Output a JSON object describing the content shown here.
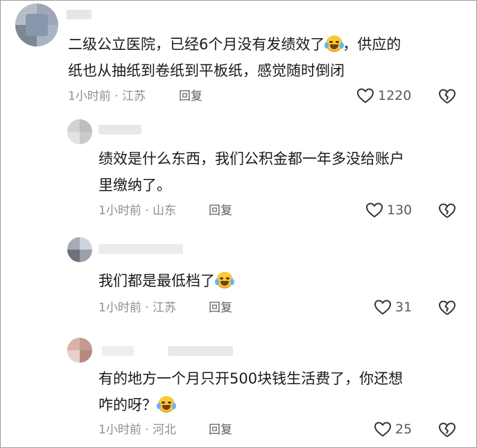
{
  "comments": [
    {
      "text_line1": "二级公立医院，已经6个月没有发绩效了",
      "text_line1b": "，供应的",
      "text_line2": "纸也从抽纸到卷纸到平板纸，感觉随时倒闭",
      "time": "1小时前",
      "location": "江苏",
      "reply_label": "回复",
      "likes": "1220"
    },
    {
      "text_line1": "绩效是什么东西，我们公积金都一年多没给账户",
      "text_line2": "里缴纳了。",
      "time": "1小时前",
      "location": "山东",
      "reply_label": "回复",
      "likes": "130"
    },
    {
      "text_line1": "我们都是最低档了",
      "time": "1小时前",
      "location": "江苏",
      "reply_label": "回复",
      "likes": "31"
    },
    {
      "text_line1": "有的地方一个月只开500块钱生活费了，你还想",
      "text_line2": "咋的呀？",
      "time": "1小时前",
      "location": "河北",
      "reply_label": "回复",
      "likes": "25"
    }
  ],
  "separator": " · ",
  "icons": {
    "like": "heart-outline-icon",
    "dislike": "broken-heart-icon",
    "emoji": "crying-laughing-emoji-icon"
  }
}
